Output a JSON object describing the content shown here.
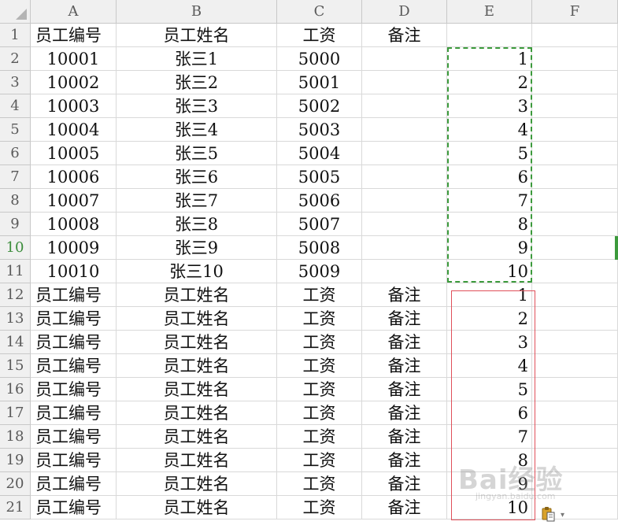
{
  "columns": [
    "A",
    "B",
    "C",
    "D",
    "E",
    "F"
  ],
  "rows": [
    {
      "num": "1",
      "cells": [
        "员工编号",
        "员工姓名",
        "工资",
        "备注",
        "",
        ""
      ]
    },
    {
      "num": "2",
      "cells": [
        "10001",
        "张三1",
        "5000",
        "",
        "1",
        ""
      ]
    },
    {
      "num": "3",
      "cells": [
        "10002",
        "张三2",
        "5001",
        "",
        "2",
        ""
      ]
    },
    {
      "num": "4",
      "cells": [
        "10003",
        "张三3",
        "5002",
        "",
        "3",
        ""
      ]
    },
    {
      "num": "5",
      "cells": [
        "10004",
        "张三4",
        "5003",
        "",
        "4",
        ""
      ]
    },
    {
      "num": "6",
      "cells": [
        "10005",
        "张三5",
        "5004",
        "",
        "5",
        ""
      ]
    },
    {
      "num": "7",
      "cells": [
        "10006",
        "张三6",
        "5005",
        "",
        "6",
        ""
      ]
    },
    {
      "num": "8",
      "cells": [
        "10007",
        "张三7",
        "5006",
        "",
        "7",
        ""
      ]
    },
    {
      "num": "9",
      "cells": [
        "10008",
        "张三8",
        "5007",
        "",
        "8",
        ""
      ]
    },
    {
      "num": "10",
      "cells": [
        "10009",
        "张三9",
        "5008",
        "",
        "9",
        ""
      ]
    },
    {
      "num": "11",
      "cells": [
        "10010",
        "张三10",
        "5009",
        "",
        "10",
        ""
      ]
    },
    {
      "num": "12",
      "cells": [
        "员工编号",
        "员工姓名",
        "工资",
        "备注",
        "1",
        ""
      ]
    },
    {
      "num": "13",
      "cells": [
        "员工编号",
        "员工姓名",
        "工资",
        "备注",
        "2",
        ""
      ]
    },
    {
      "num": "14",
      "cells": [
        "员工编号",
        "员工姓名",
        "工资",
        "备注",
        "3",
        ""
      ]
    },
    {
      "num": "15",
      "cells": [
        "员工编号",
        "员工姓名",
        "工资",
        "备注",
        "4",
        ""
      ]
    },
    {
      "num": "16",
      "cells": [
        "员工编号",
        "员工姓名",
        "工资",
        "备注",
        "5",
        ""
      ]
    },
    {
      "num": "17",
      "cells": [
        "员工编号",
        "员工姓名",
        "工资",
        "备注",
        "6",
        ""
      ]
    },
    {
      "num": "18",
      "cells": [
        "员工编号",
        "员工姓名",
        "工资",
        "备注",
        "7",
        ""
      ]
    },
    {
      "num": "19",
      "cells": [
        "员工编号",
        "员工姓名",
        "工资",
        "备注",
        "8",
        ""
      ]
    },
    {
      "num": "20",
      "cells": [
        "员工编号",
        "员工姓名",
        "工资",
        "备注",
        "9",
        ""
      ]
    },
    {
      "num": "21",
      "cells": [
        "员工编号",
        "员工姓名",
        "工资",
        "备注",
        "10",
        ""
      ]
    }
  ],
  "active_row": "10",
  "copy_range": "E2:E11",
  "highlight_range": "E12:E21",
  "paste_options": {
    "icon": "clipboard-paste-icon",
    "arrow": "▾"
  },
  "watermark": {
    "brand": "Bai经验",
    "site": "jingyan.baidu.com"
  },
  "colors": {
    "header_bg": "#f0f0f0",
    "grid": "#d9d9d9",
    "marquee": "#3c9a3c",
    "highlight": "#e0505a",
    "active_row_text": "#3c8d3c"
  }
}
